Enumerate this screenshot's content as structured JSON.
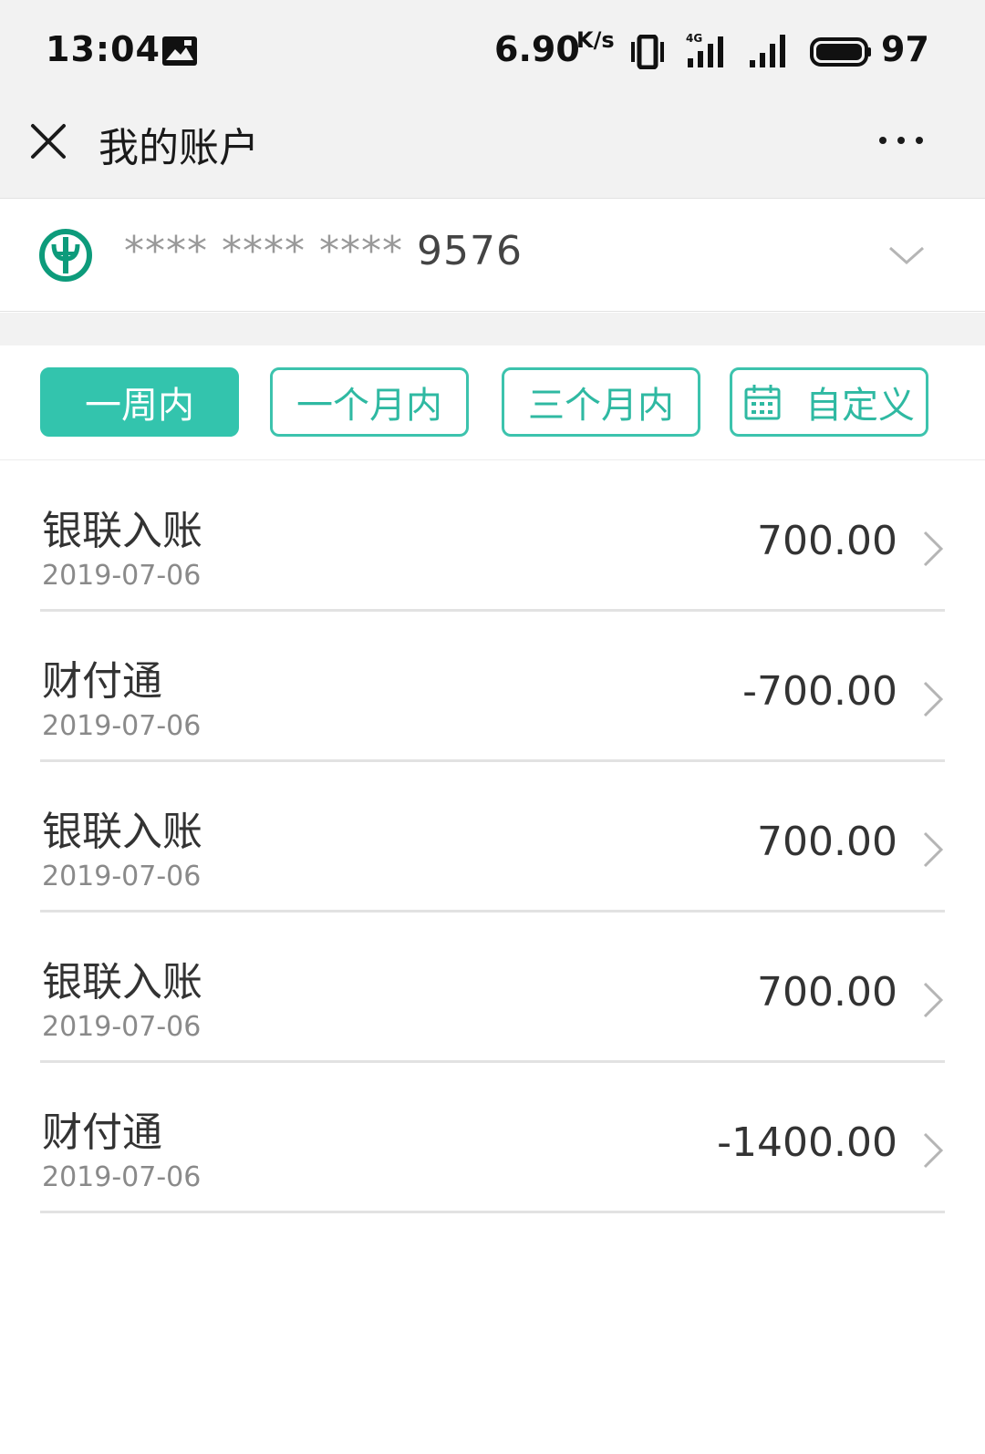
{
  "status_bar": {
    "time": "13:04",
    "speed": "6.90",
    "speed_unit": "K/s",
    "battery": "97",
    "icons": [
      "image-icon",
      "vibrate-icon",
      "4g-signal-icon",
      "signal-icon",
      "battery-icon"
    ]
  },
  "header": {
    "title": "我的账户",
    "close_icon": "close-icon",
    "more_icon": "more-icon"
  },
  "account": {
    "mask": "**** **** ****",
    "last4": "9576",
    "bank_icon": "bank-logo-icon",
    "brand_color": "#0d9b7b"
  },
  "filters": [
    {
      "label": "一周内",
      "active": true
    },
    {
      "label": "一个月内",
      "active": false
    },
    {
      "label": "三个月内",
      "active": false
    },
    {
      "label": "自定义",
      "active": false,
      "icon": "calendar-icon"
    }
  ],
  "accent_color": "#33c4ad",
  "transactions": [
    {
      "name": "银联入账",
      "date": "2019-07-06",
      "amount": "700.00"
    },
    {
      "name": "财付通",
      "date": "2019-07-06",
      "amount": "-700.00"
    },
    {
      "name": "银联入账",
      "date": "2019-07-06",
      "amount": "700.00"
    },
    {
      "name": "银联入账",
      "date": "2019-07-06",
      "amount": "700.00"
    },
    {
      "name": "财付通",
      "date": "2019-07-06",
      "amount": "-1400.00"
    }
  ]
}
